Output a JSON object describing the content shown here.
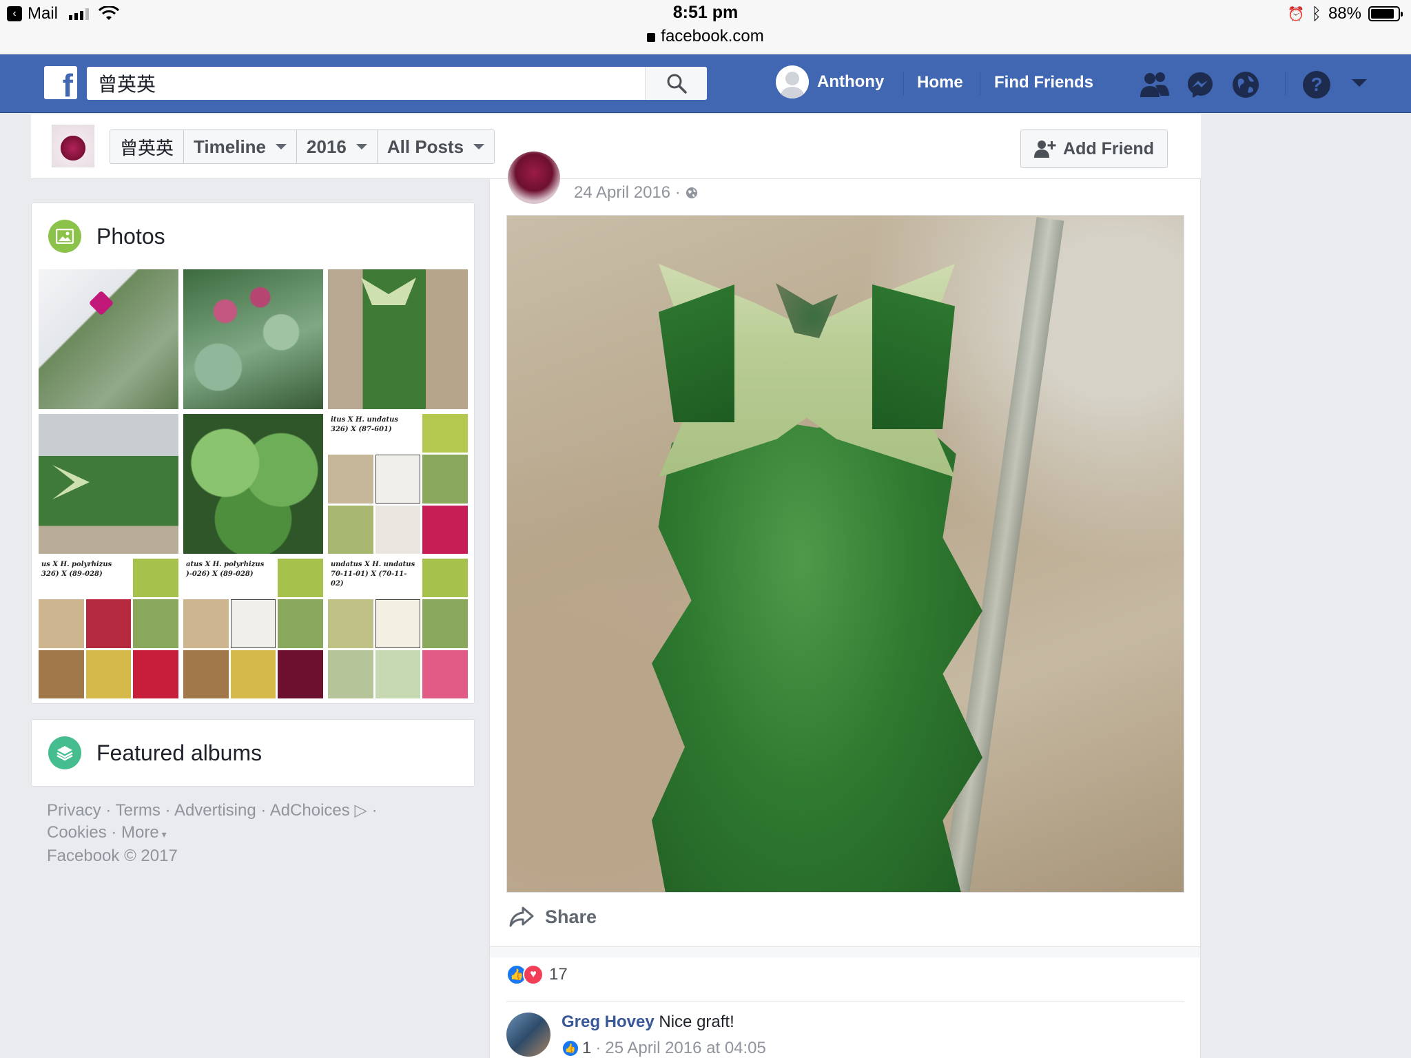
{
  "statusbar": {
    "back_app": "Mail",
    "time": "8:51 pm",
    "url": "facebook.com",
    "battery": "88%",
    "battery_level": 0.88
  },
  "fbbar": {
    "logo": "f",
    "search_value": "曾英英",
    "profile_name": "Anthony",
    "nav_home": "Home",
    "nav_find_friends": "Find Friends"
  },
  "subbar": {
    "crumbs": [
      "曾英英",
      "Timeline",
      "2016",
      "All Posts"
    ],
    "add_friend": "Add Friend"
  },
  "photos": {
    "title": "Photos",
    "collage_captions": [
      "itus X H. undatus 326) X (87-601)",
      "us X H. polyrhizus 326) X (89-028)",
      "atus X H. polyrhizus )-026) X (89-028)",
      "undatus X H. undatus 70-11-01) X (70-11-02)"
    ]
  },
  "albums": {
    "title": "Featured albums"
  },
  "footer": {
    "links": [
      "Privacy",
      "Terms",
      "Advertising",
      "AdChoices",
      "Cookies",
      "More"
    ],
    "copyright": "Facebook © 2017"
  },
  "post": {
    "date": "24 April 2016",
    "share_label": "Share",
    "reaction_count": "17",
    "comment": {
      "author": "Greg Hovey",
      "text": "Nice graft!",
      "likes": "1",
      "timestamp": "25 April 2016 at 04:05"
    }
  },
  "colors": {
    "fb_blue": "#4267b2",
    "link_blue": "#385898",
    "like_blue": "#1877f2",
    "love_red": "#f33e58",
    "photos_icon_green": "#8bc34a",
    "albums_icon_teal": "#45bd8f"
  }
}
